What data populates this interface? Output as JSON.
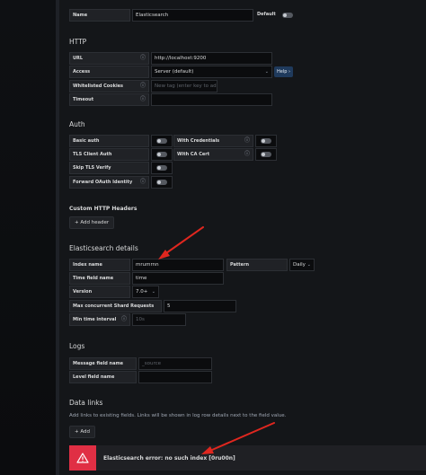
{
  "top": {
    "name_label": "Name",
    "name_value": "Elasticsearch",
    "default_label": "Default"
  },
  "http": {
    "title": "HTTP",
    "url_label": "URL",
    "url_value": "http://localhost:9200",
    "access_label": "Access",
    "access_value": "Server (default)",
    "help_label": "Help",
    "cookies_label": "Whitelisted Cookies",
    "cookies_placeholder": "New tag (enter key to add",
    "timeout_label": "Timeout"
  },
  "auth": {
    "title": "Auth",
    "basic_auth": "Basic auth",
    "with_credentials": "With Credentials",
    "tls_client_auth": "TLS Client Auth",
    "with_ca_cert": "With CA Cert",
    "skip_tls": "Skip TLS Verify",
    "forward_oauth": "Forward OAuth Identity"
  },
  "custom_headers": {
    "title": "Custom HTTP Headers",
    "add_header": "Add header"
  },
  "es": {
    "title": "Elasticsearch details",
    "index_label": "Index name",
    "index_value": "mrumrnn",
    "pattern_label": "Pattern",
    "pattern_value": "Daily",
    "time_field_label": "Time field name",
    "time_field_value": "time",
    "version_label": "Version",
    "version_value": "7.0+",
    "shard_label": "Max concurrent Shard Requests",
    "shard_value": "5",
    "min_interval_label": "Min time interval",
    "min_interval_placeholder": "10s"
  },
  "logs": {
    "title": "Logs",
    "message_label": "Message field name",
    "message_placeholder": "_source",
    "level_label": "Level field name"
  },
  "data_links": {
    "title": "Data links",
    "description": "Add links to existing fields. Links will be shown in log row details next to the field value.",
    "add_label": "Add"
  },
  "error": {
    "message": "Elasticsearch error: no such index [0ru00n]"
  },
  "colors": {
    "background": "#141619",
    "input_bg": "#0b0c0e",
    "label_bg": "#202226",
    "error_red": "#e02f44",
    "arrow_red": "#e0271f",
    "help_blue": "#1f3a5c"
  },
  "icons": {
    "info": "info-circle-icon",
    "plus": "plus-icon",
    "warning": "warning-triangle-icon",
    "caret": "chevron-down-icon"
  }
}
